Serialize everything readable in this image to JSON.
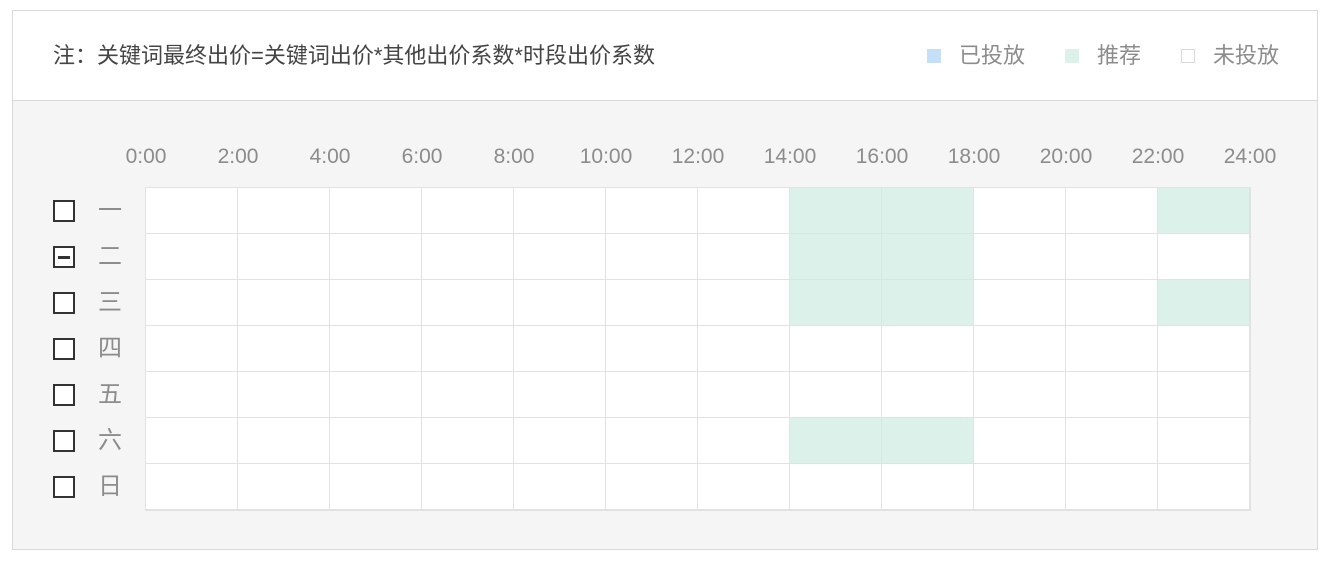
{
  "header": {
    "note": "注：关键词最终出价=关键词出价*其他出价系数*时段出价系数"
  },
  "legend": [
    {
      "label": "已投放",
      "color": "#c6dff8",
      "border": "#c6dff8"
    },
    {
      "label": "推荐",
      "color": "#dcf1ea",
      "border": "#dcf1ea"
    },
    {
      "label": "未投放",
      "color": "#ffffff",
      "border": "#d9d9d9"
    }
  ],
  "time_axis": [
    "0:00",
    "2:00",
    "4:00",
    "6:00",
    "8:00",
    "10:00",
    "12:00",
    "14:00",
    "16:00",
    "18:00",
    "20:00",
    "22:00",
    "24:00"
  ],
  "colors": {
    "recommend": "#dcf1ea",
    "active": "#cfe3fa",
    "inactive": "#ffffff",
    "gridline": "#e2e2e2"
  },
  "days": [
    {
      "label": "一",
      "checkbox": "unchecked"
    },
    {
      "label": "二",
      "checkbox": "indeterminate"
    },
    {
      "label": "三",
      "checkbox": "unchecked"
    },
    {
      "label": "四",
      "checkbox": "unchecked"
    },
    {
      "label": "五",
      "checkbox": "unchecked"
    },
    {
      "label": "六",
      "checkbox": "unchecked"
    },
    {
      "label": "日",
      "checkbox": "unchecked"
    }
  ],
  "schedule": {
    "hours_per_column": 2,
    "rows": [
      [
        "inactive",
        "inactive",
        "inactive",
        "inactive",
        "inactive",
        "inactive",
        "inactive",
        "recommend",
        "recommend",
        "inactive",
        "inactive",
        "recommend"
      ],
      [
        "inactive",
        "inactive",
        "inactive",
        "inactive",
        "inactive",
        "inactive",
        "inactive",
        "recommend",
        "recommend",
        "inactive",
        "inactive",
        "inactive"
      ],
      [
        "inactive",
        "inactive",
        "inactive",
        "inactive",
        "inactive",
        "inactive",
        "inactive",
        "recommend",
        "recommend",
        "inactive",
        "inactive",
        "recommend"
      ],
      [
        "inactive",
        "inactive",
        "inactive",
        "inactive",
        "inactive",
        "inactive",
        "inactive",
        "inactive",
        "inactive",
        "inactive",
        "inactive",
        "inactive"
      ],
      [
        "inactive",
        "inactive",
        "inactive",
        "inactive",
        "inactive",
        "inactive",
        "inactive",
        "inactive",
        "inactive",
        "inactive",
        "inactive",
        "inactive"
      ],
      [
        "inactive",
        "inactive",
        "inactive",
        "inactive",
        "inactive",
        "inactive",
        "inactive",
        "recommend",
        "recommend",
        "inactive",
        "inactive",
        "inactive"
      ],
      [
        "inactive",
        "inactive",
        "inactive",
        "inactive",
        "inactive",
        "inactive",
        "inactive",
        "inactive",
        "inactive",
        "inactive",
        "inactive",
        "inactive"
      ]
    ]
  }
}
